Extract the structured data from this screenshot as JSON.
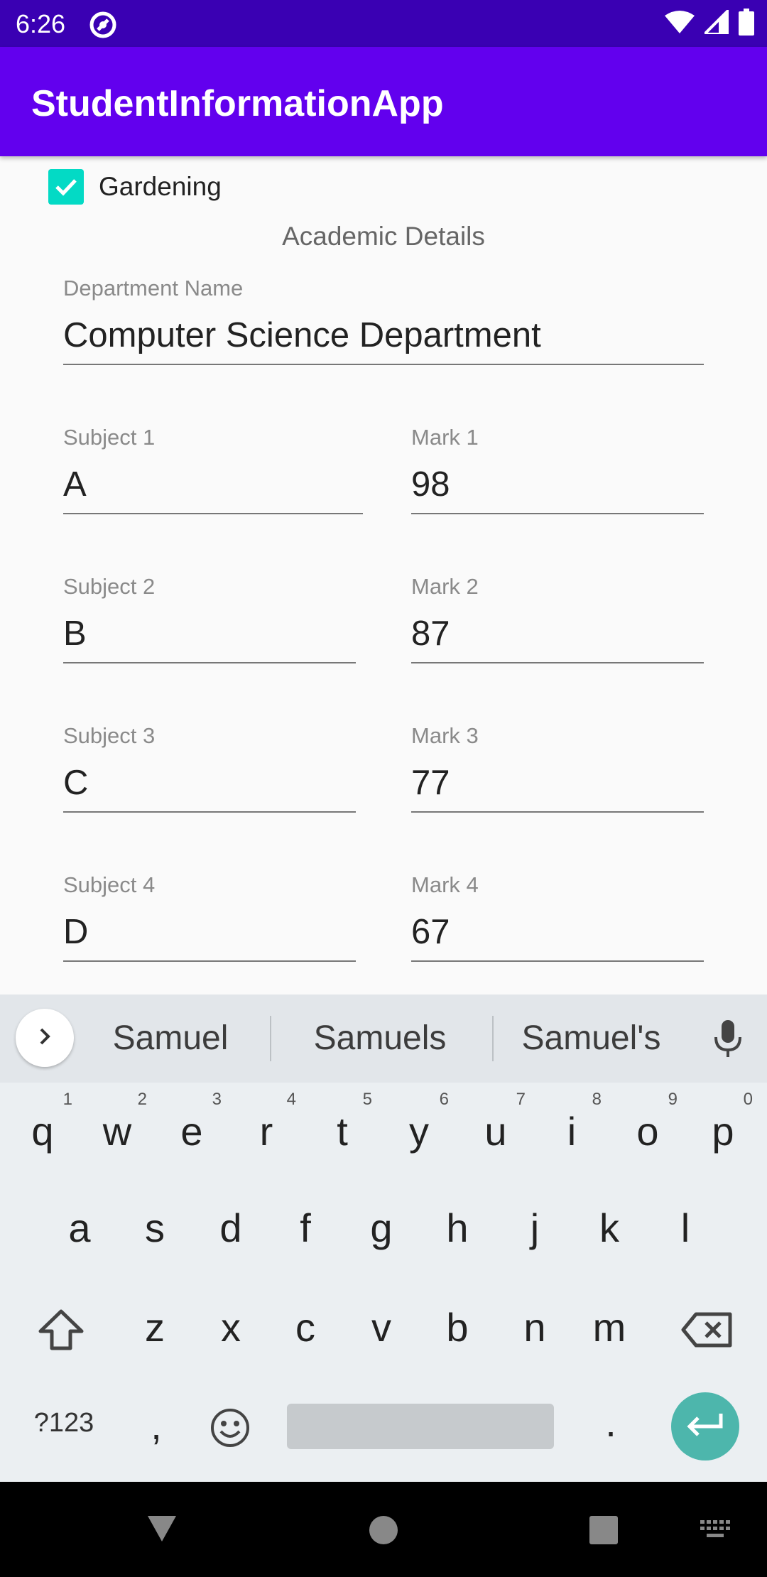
{
  "status_bar": {
    "time": "6:26"
  },
  "app_bar": {
    "title": "StudentInformationApp"
  },
  "hobby": {
    "label": "Gardening",
    "checked": true
  },
  "section": {
    "title": "Academic Details"
  },
  "department": {
    "label": "Department Name",
    "value": "Computer Science Department"
  },
  "subjects": [
    {
      "subject_label": "Subject 1",
      "subject_value": "A",
      "mark_label": "Mark 1",
      "mark_value": "98"
    },
    {
      "subject_label": "Subject 2",
      "subject_value": "B",
      "mark_label": "Mark 2",
      "mark_value": "87"
    },
    {
      "subject_label": "Subject 3",
      "subject_value": "C",
      "mark_label": "Mark 3",
      "mark_value": "77"
    },
    {
      "subject_label": "Subject 4",
      "subject_value": "D",
      "mark_label": "Mark 4",
      "mark_value": "67"
    }
  ],
  "keyboard": {
    "suggestions": [
      "Samuel",
      "Samuels",
      "Samuel's"
    ],
    "row1": [
      "q",
      "w",
      "e",
      "r",
      "t",
      "y",
      "u",
      "i",
      "o",
      "p"
    ],
    "row1_hints": [
      "1",
      "2",
      "3",
      "4",
      "5",
      "6",
      "7",
      "8",
      "9",
      "0"
    ],
    "row2": [
      "a",
      "s",
      "d",
      "f",
      "g",
      "h",
      "j",
      "k",
      "l"
    ],
    "row3": [
      "z",
      "x",
      "c",
      "v",
      "b",
      "n",
      "m"
    ],
    "symbols_label": "?123",
    "comma": ",",
    "period": ".",
    "enter_color": "#4db6ac"
  },
  "colors": {
    "status_bar": "#3a00b3",
    "app_bar": "#6200ee",
    "checkbox": "#03dac5"
  }
}
